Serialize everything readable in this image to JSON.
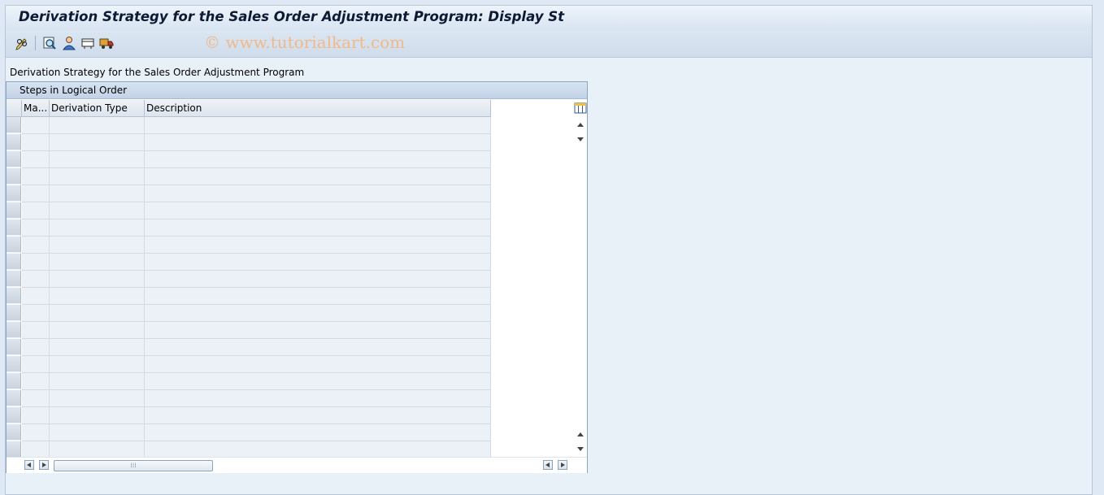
{
  "window": {
    "title": "Derivation Strategy for the Sales Order Adjustment Program: Display St",
    "watermark": "© www.tutorialkart.com"
  },
  "toolbar": {
    "buttons": [
      {
        "icon": "pencil-glasses-icon"
      },
      {
        "icon": "find-icon"
      },
      {
        "icon": "person-icon"
      },
      {
        "icon": "display-icon"
      },
      {
        "icon": "transport-truck-icon"
      }
    ]
  },
  "main": {
    "section_label": "Derivation Strategy for the Sales Order Adjustment Program",
    "panel_title": "Steps in Logical Order",
    "table": {
      "columns": [
        "Ma...",
        "Derivation Type",
        "Description"
      ],
      "rows": [
        [
          "",
          "",
          ""
        ],
        [
          "",
          "",
          ""
        ],
        [
          "",
          "",
          ""
        ],
        [
          "",
          "",
          ""
        ],
        [
          "",
          "",
          ""
        ],
        [
          "",
          "",
          ""
        ],
        [
          "",
          "",
          ""
        ],
        [
          "",
          "",
          ""
        ],
        [
          "",
          "",
          ""
        ],
        [
          "",
          "",
          ""
        ],
        [
          "",
          "",
          ""
        ],
        [
          "",
          "",
          ""
        ],
        [
          "",
          "",
          ""
        ],
        [
          "",
          "",
          ""
        ],
        [
          "",
          "",
          ""
        ],
        [
          "",
          "",
          ""
        ],
        [
          "",
          "",
          ""
        ],
        [
          "",
          "",
          ""
        ],
        [
          "",
          "",
          ""
        ],
        [
          "",
          "",
          ""
        ]
      ]
    }
  },
  "colors": {
    "background": "#dfe9f5",
    "row_bg": "#ebf1f7",
    "watermark": "#f0b98a"
  }
}
